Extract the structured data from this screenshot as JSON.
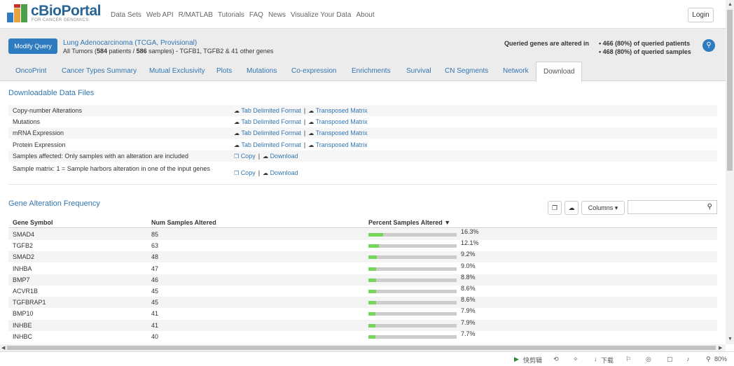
{
  "brand": {
    "name": "cBioPortal",
    "tagline": "FOR CANCER GENOMICS"
  },
  "nav": [
    "Data Sets",
    "Web API",
    "R/MATLAB",
    "Tutorials",
    "FAQ",
    "News",
    "Visualize Your Data",
    "About"
  ],
  "login_label": "Login",
  "query": {
    "modify_label": "Modify Query",
    "study": "Lung Adenocarcinoma (TCGA, Provisional)",
    "samples_prefix": "All Tumors (",
    "patients": "584",
    "patients_word": " patients / ",
    "samples": "586",
    "samples_suffix": " samples) - TGFB1, TGFB2 & 41 other genes",
    "altered_label": "Queried genes are altered in",
    "altered_patients": "• 466 (80%) of queried patients",
    "altered_samples": "• 468 (80%) of queried samples"
  },
  "tabs": [
    "OncoPrint",
    "Cancer Types Summary",
    "Mutual Exclusivity",
    "Plots",
    "Mutations",
    "Co-expression",
    "Enrichments",
    "Survival",
    "CN Segments",
    "Network",
    "Download"
  ],
  "downloads": {
    "title": "Downloadable Data Files",
    "tab_delimited": "Tab Delimited Format",
    "transposed": "Transposed Matrix",
    "copy": "Copy",
    "download": "Download",
    "separator": "|",
    "rows": [
      "Copy-number Alterations",
      "Mutations",
      "mRNA Expression",
      "Protein Expression"
    ],
    "samples_affected": "Samples affected: Only samples with an alteration are included",
    "sample_matrix": "Sample matrix: 1 = Sample harbors alteration in one of the input genes"
  },
  "gene_freq": {
    "title": "Gene Alteration Frequency",
    "columns_label": "Columns",
    "headers": {
      "gene": "Gene Symbol",
      "num": "Num Samples Altered",
      "pct": "Percent Samples Altered ▼"
    },
    "rows": [
      {
        "gene": "SMAD4",
        "num": "85",
        "pct": "16.3%",
        "frac": 0.163
      },
      {
        "gene": "TGFB2",
        "num": "63",
        "pct": "12.1%",
        "frac": 0.121
      },
      {
        "gene": "SMAD2",
        "num": "48",
        "pct": "9.2%",
        "frac": 0.092
      },
      {
        "gene": "INHBA",
        "num": "47",
        "pct": "9.0%",
        "frac": 0.09
      },
      {
        "gene": "BMP7",
        "num": "46",
        "pct": "8.8%",
        "frac": 0.088
      },
      {
        "gene": "ACVR1B",
        "num": "45",
        "pct": "8.6%",
        "frac": 0.086
      },
      {
        "gene": "TGFBRAP1",
        "num": "45",
        "pct": "8.6%",
        "frac": 0.086
      },
      {
        "gene": "BMP10",
        "num": "41",
        "pct": "7.9%",
        "frac": 0.079
      },
      {
        "gene": "INHBE",
        "num": "41",
        "pct": "7.9%",
        "frac": 0.079
      },
      {
        "gene": "INHBC",
        "num": "40",
        "pct": "7.7%",
        "frac": 0.077
      }
    ]
  },
  "statusbar": {
    "clip": "快剪辑",
    "download": "下载",
    "zoom": "80%"
  },
  "colors": {
    "accent": "#2f7bbf",
    "bar_fill": "#75d659",
    "bar_bg": "#cccccc"
  }
}
